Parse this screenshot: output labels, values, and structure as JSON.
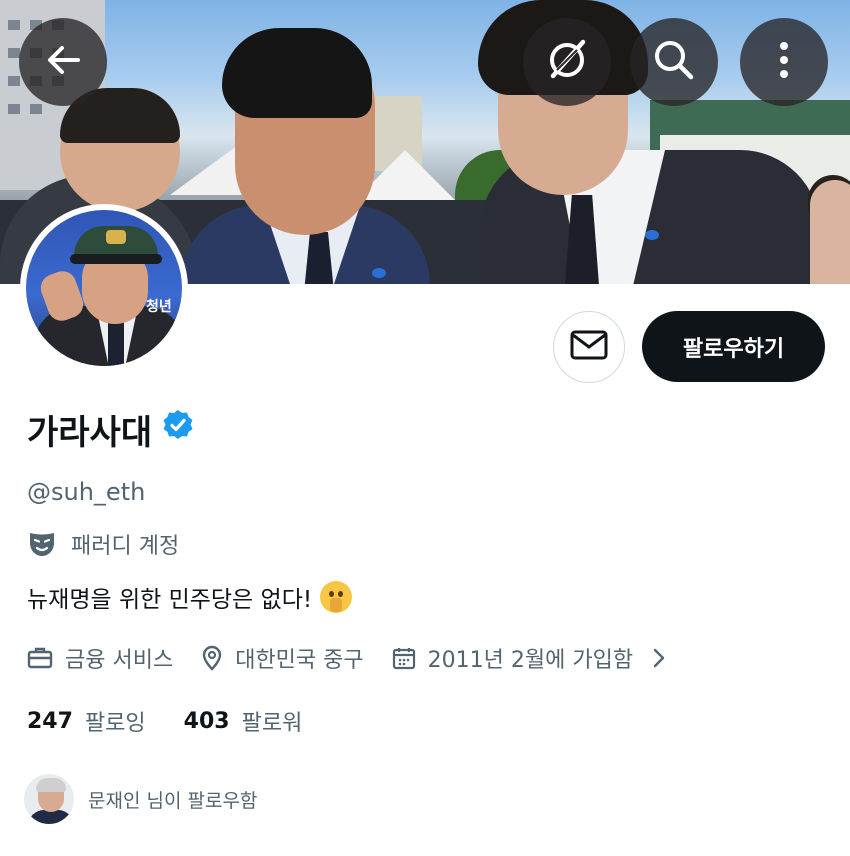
{
  "profile": {
    "display_name": "가라사대",
    "handle": "@suh_eth",
    "parody_label": "패러디 계정",
    "bio": "뉴재명을 위한 민주당은 없다!",
    "bio_emoji": "shushing-face-emoji",
    "verified": true,
    "avatar_text": "청년"
  },
  "actions": {
    "follow_label": "팔로우하기",
    "message_icon": "mail-icon"
  },
  "meta": {
    "category": "금융 서비스",
    "location": "대한민국 중구",
    "joined": "2011년 2월에 가입함"
  },
  "stats": {
    "following_count": "247",
    "following_label": "팔로잉",
    "followers_count": "403",
    "followers_label": "팔로워"
  },
  "followed_by": {
    "text": "문재인 님이 팔로우함"
  },
  "header_buttons": [
    "back-arrow-icon",
    "grok-icon",
    "search-icon",
    "more-vertical-icon"
  ],
  "colors": {
    "text_primary": "#0f1419",
    "text_secondary": "#536471",
    "verified_blue": "#1d9bf0",
    "follow_button_bg": "#0f1419"
  }
}
